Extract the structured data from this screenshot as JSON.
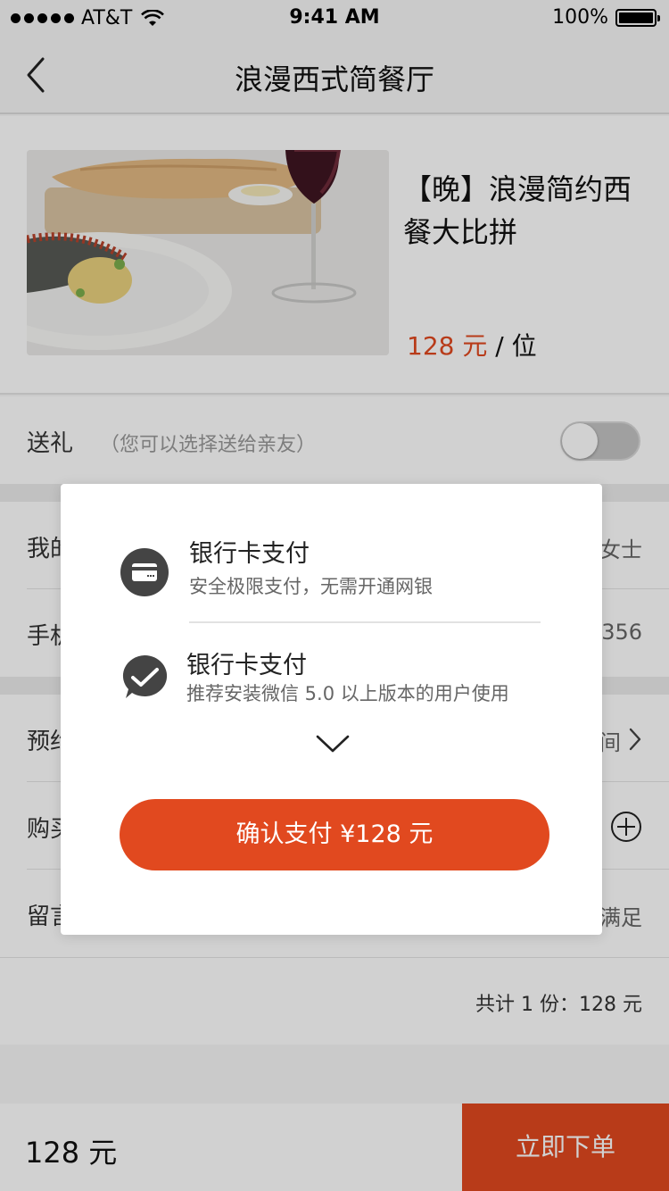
{
  "status_bar": {
    "carrier": "AT&T",
    "time": "9:41 AM",
    "battery": "100%"
  },
  "nav": {
    "title": "浪漫西式简餐厅",
    "back_icon": "chevron-left-icon"
  },
  "product": {
    "title": "【晚】浪漫简约西餐大比拼",
    "price_amount": "128 元",
    "price_unit": " / 位",
    "image": "food-photo"
  },
  "gift": {
    "label": "送礼",
    "hint": "（您可以选择送给亲友）",
    "toggle_on": false
  },
  "form": {
    "rows": [
      {
        "label": "我的",
        "value": "女士"
      },
      {
        "label": "手机",
        "value": "356"
      },
      {
        "label": "预约",
        "value": "间"
      },
      {
        "label": "购买",
        "value": ""
      },
      {
        "label": "留言",
        "value": "满足"
      }
    ],
    "plus_icon": "plus-circle-icon",
    "chevron_icon": "chevron-right-icon"
  },
  "total": {
    "text": "共计 1 份：128 元"
  },
  "bottom_bar": {
    "price": "128 元",
    "order_label": "立即下单"
  },
  "modal": {
    "options": [
      {
        "icon": "bank-card-icon",
        "title": "银行卡支付",
        "desc": "安全极限支付，无需开通网银"
      },
      {
        "icon": "wechat-icon",
        "title": "银行卡支付",
        "desc": "推荐安装微信 5.0 以上版本的用户使用"
      }
    ],
    "expand_icon": "chevron-down-icon",
    "confirm_label": "确认支付 ¥128 元"
  },
  "colors": {
    "accent": "#e1491f",
    "background": "#f7f7f7",
    "overlay": "rgba(0,0,0,0.18)"
  }
}
